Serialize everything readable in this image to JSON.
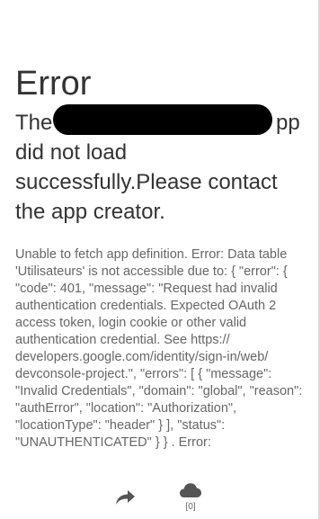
{
  "error": {
    "title": "Error",
    "message_prefix": "The",
    "message_suffix_first_line": "pp",
    "message_rest": "did not load successfully.Please contact the app creator.",
    "details": "Unable to fetch app definition. Error: Data table 'Utilisateurs' is not accessible due to: { \"error\": { \"code\": 401, \"message\": \"Request had invalid authentication credentials. Expected OAuth 2 access token, login cookie or other valid authentication credential. See https:// developers.google.com/identity/sign-in/web/ devconsole-project.\", \"errors\": [ { \"message\": \"Invalid Credentials\", \"domain\": \"global\", \"reason\": \"authError\", \"location\": \"Authorization\", \"locationType\": \"header\" } ], \"status\": \"UNAUTHENTICATED\" } } . Error:"
  },
  "toolbar": {
    "share_icon": "share-arrow-icon",
    "cloud_icon": "cloud-icon",
    "cloud_count": "[0]"
  },
  "colors": {
    "title_text": "#333333",
    "detail_text": "#666666",
    "icon": "#555555",
    "redaction": "#000000"
  }
}
